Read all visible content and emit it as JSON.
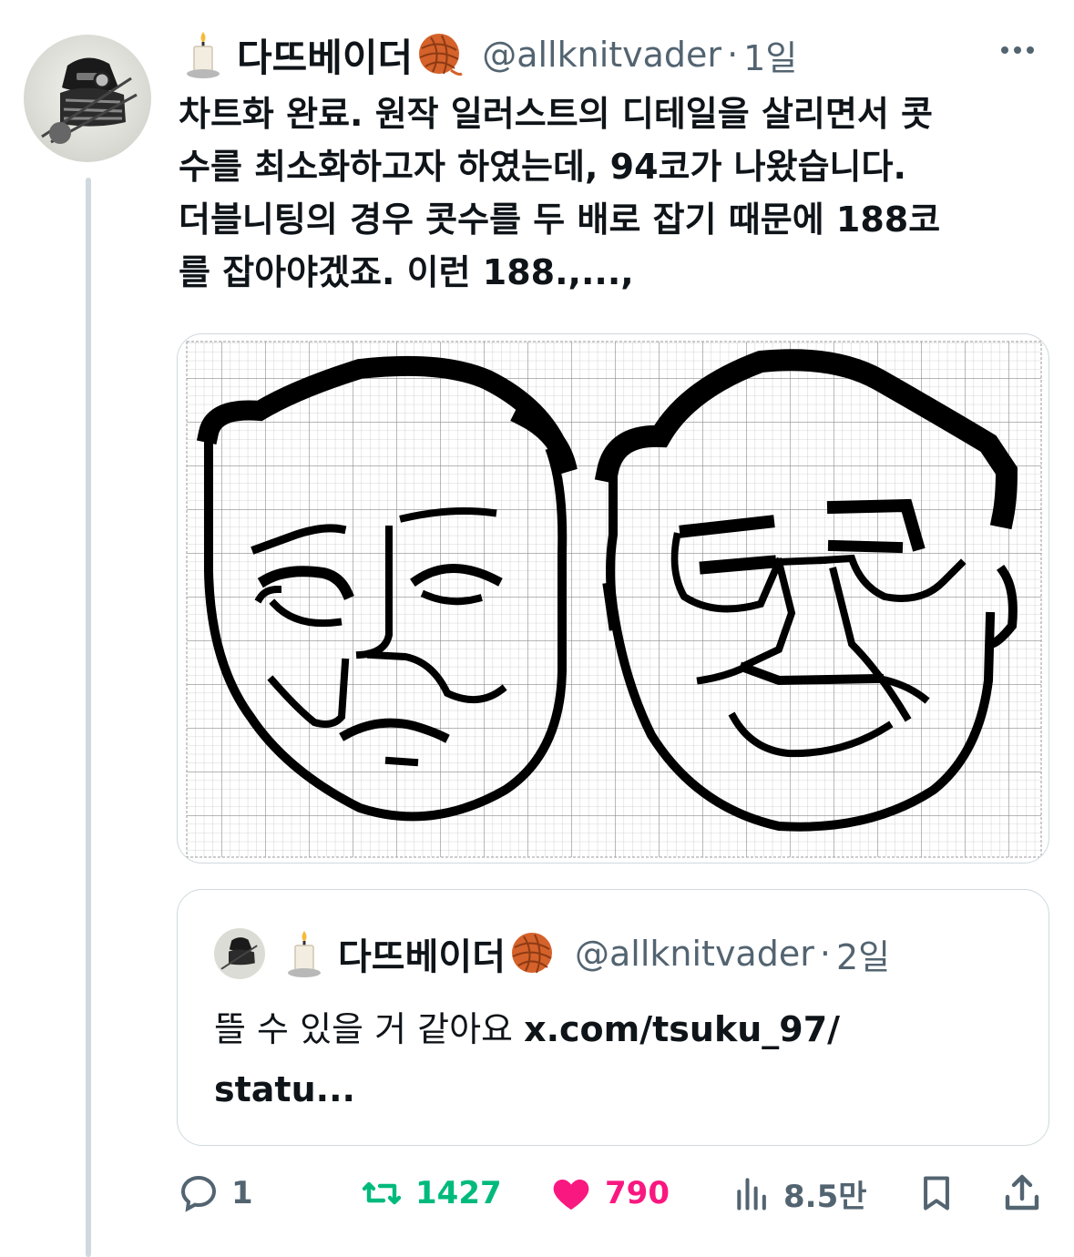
{
  "tweet": {
    "author_name": "다뜨베이더",
    "handle": "@allknitvader",
    "separator": "·",
    "time": "1일",
    "text": "차트화 완료. 원작 일러스트의 디테일을 살리면서 콧\n수를 최소화하고자 하였는데, 94코가 나왔습니다.\n더블니팅의 경우 콧수를 두 배로 잡기 때문에 188코\n를 잡아야겠죠. 이런 188.,...,",
    "name_icons": [
      "candle-icon",
      "yarn-ball-icon"
    ]
  },
  "quote": {
    "author_name": "다뜨베이더",
    "handle": "@allknitvader",
    "separator": "·",
    "time": "2일",
    "text": "뜰 수 있을 거 같아요 ",
    "link": "x.com/tsuku_97/\nstatu..."
  },
  "actions": {
    "replies": "1",
    "retweets": "1427",
    "likes": "790",
    "views": "8.5만"
  },
  "colors": {
    "text": "#0f1419",
    "secondary": "#536471",
    "retweet": "#00ba7c",
    "like": "#f91880",
    "border": "#cfd9de",
    "thread_line": "#cfd9de"
  }
}
